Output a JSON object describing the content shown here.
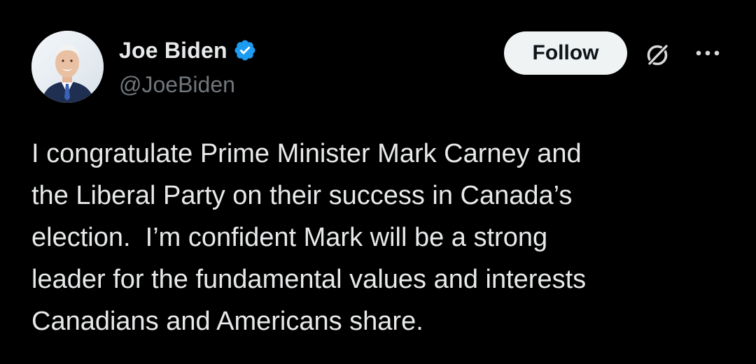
{
  "author": {
    "display_name": "Joe Biden",
    "handle": "@JoeBiden",
    "avatar_icon": "profile-photo",
    "verified_icon": "verified-badge-icon",
    "verified_color": "#1d9bf0"
  },
  "actions": {
    "follow_label": "Follow",
    "grok_icon": "grok-icon",
    "more_icon": "more-options-icon"
  },
  "tweet": {
    "text": "I congratulate Prime Minister Mark Carney and\nthe Liberal Party on their success in Canada’s\nelection.  I’m confident Mark will be a strong\nleader for the fundamental values and interests\nCanadians and Americans share."
  },
  "colors": {
    "background": "#000000",
    "primary_text": "#e7e9ea",
    "secondary_text": "#71767b",
    "button_bg": "#eff3f4",
    "button_text": "#0f1419"
  }
}
